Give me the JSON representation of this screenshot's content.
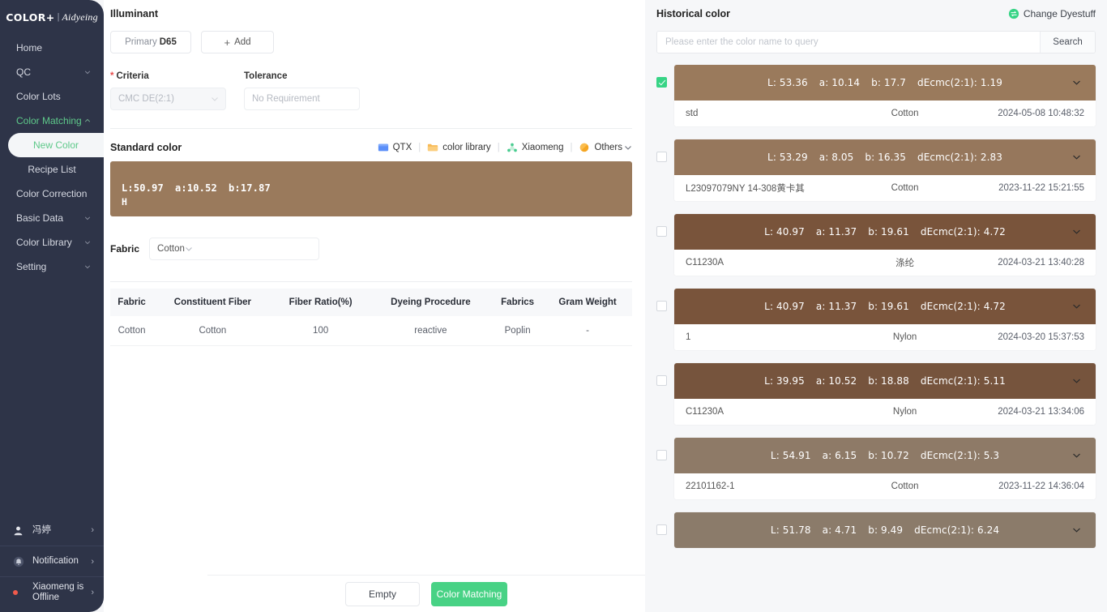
{
  "brand": {
    "name": "COLOR+",
    "separator": "|",
    "sub": "Aidyeing"
  },
  "sidebar": {
    "items": [
      {
        "label": "Home",
        "expandable": false
      },
      {
        "label": "QC",
        "expandable": true
      },
      {
        "label": "Color Lots",
        "expandable": false
      },
      {
        "label": "Color Matching",
        "expandable": true,
        "open": true
      }
    ],
    "sub_items": [
      {
        "label": "New Color",
        "active": true
      },
      {
        "label": "Recipe List",
        "active": false
      }
    ],
    "items_after": [
      {
        "label": "Color Correction",
        "expandable": false
      },
      {
        "label": "Basic Data",
        "expandable": true
      },
      {
        "label": "Color Library",
        "expandable": true
      },
      {
        "label": "Setting",
        "expandable": true
      }
    ],
    "bottom": [
      {
        "label": "冯婷",
        "icon": "user-icon"
      },
      {
        "label": "Notification",
        "icon": "bell-icon"
      },
      {
        "label": "Xiaomeng is Offline",
        "icon": "status-dot-icon"
      }
    ]
  },
  "illuminant": {
    "title": "Illuminant",
    "primary_prefix": "Primary",
    "primary_value": "D65",
    "add_label": "Add"
  },
  "criteria": {
    "label": "Criteria",
    "required_mark": "*",
    "value": "CMC DE(2:1)"
  },
  "tolerance": {
    "label": "Tolerance",
    "placeholder": "No Requirement",
    "value": ""
  },
  "standard_color": {
    "title": "Standard color",
    "sources": [
      {
        "label": "QTX",
        "icon": "qtx-icon",
        "color": "#5b8ff9"
      },
      {
        "label": "color library",
        "icon": "folder-icon",
        "color": "#f7b955"
      },
      {
        "label": "Xiaomeng",
        "icon": "molecule-icon",
        "color": "#49cc90"
      },
      {
        "label": "Others",
        "icon": "circle-icon",
        "color": "#f5a623",
        "has_chevron": true
      }
    ],
    "swatch_color": "#9a7a5c",
    "L": "L:50.97",
    "a": "a:10.52",
    "b": "b:17.87",
    "extra": "H"
  },
  "fabric": {
    "label": "Fabric",
    "value": "Cotton"
  },
  "fabric_table": {
    "headers": [
      "Fabric",
      "Constituent Fiber",
      "Fiber Ratio(%)",
      "Dyeing Procedure",
      "Fabrics",
      "Gram Weight"
    ],
    "rows": [
      [
        "Cotton",
        "Cotton",
        "100",
        "reactive",
        "Poplin",
        "-"
      ]
    ]
  },
  "historical": {
    "title": "Historical color",
    "change_dyestuff": "Change Dyestuff",
    "search_placeholder": "Please enter the color name to query",
    "search_value": "",
    "search_button": "Search",
    "rows": [
      {
        "checked": true,
        "color": "#9a7a5c",
        "L": "L: 53.36",
        "a": "a: 10.14",
        "b": "b: 17.7",
        "de": "dEcmc(2:1): 1.19",
        "name": "std",
        "material": "Cotton",
        "date": "2024-05-08 10:48:32"
      },
      {
        "checked": false,
        "color": "#96775c",
        "L": "L: 53.29",
        "a": "a: 8.05",
        "b": "b: 16.35",
        "de": "dEcmc(2:1): 2.83",
        "name": "L23097079NY 14-308黄卡其",
        "material": "Cotton",
        "date": "2023-11-22 15:21:55"
      },
      {
        "checked": false,
        "color": "#79543b",
        "L": "L: 40.97",
        "a": "a: 11.37",
        "b": "b: 19.61",
        "de": "dEcmc(2:1): 4.72",
        "name": "C11230A",
        "material": "涤纶",
        "date": "2024-03-21 13:40:28"
      },
      {
        "checked": false,
        "color": "#79543b",
        "L": "L: 40.97",
        "a": "a: 11.37",
        "b": "b: 19.61",
        "de": "dEcmc(2:1): 4.72",
        "name": "1",
        "material": "Nylon",
        "date": "2024-03-20 15:37:53"
      },
      {
        "checked": false,
        "color": "#76543d",
        "L": "L: 39.95",
        "a": "a: 10.52",
        "b": "b: 18.88",
        "de": "dEcmc(2:1): 5.11",
        "name": "C11230A",
        "material": "Nylon",
        "date": "2024-03-21 13:34:06"
      },
      {
        "checked": false,
        "color": "#8e7a67",
        "L": "L: 54.91",
        "a": "a: 6.15",
        "b": "b: 10.72",
        "de": "dEcmc(2:1): 5.3",
        "name": "22101162-1",
        "material": "Cotton",
        "date": "2023-11-22 14:36:04"
      },
      {
        "checked": false,
        "color": "#8b7b6a",
        "L": "L: 51.78",
        "a": "a: 4.71",
        "b": "b: 9.49",
        "de": "dEcmc(2:1): 6.24",
        "name": "",
        "material": "",
        "date": ""
      }
    ]
  },
  "footer": {
    "empty_label": "Empty",
    "match_label": "Color Matching"
  }
}
